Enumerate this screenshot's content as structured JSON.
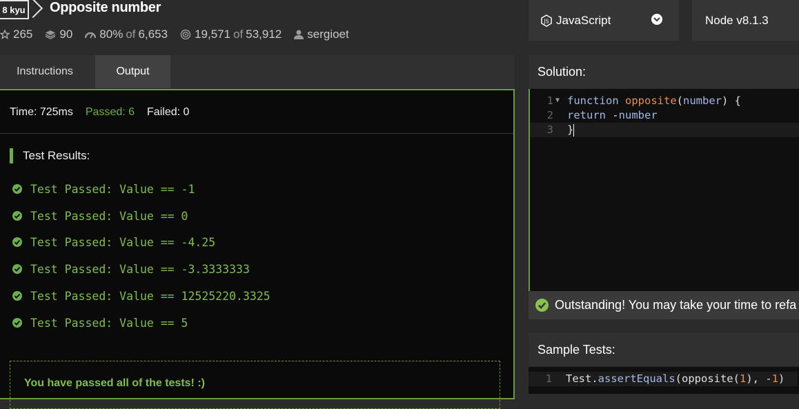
{
  "kata": {
    "kyu": "8 kyu",
    "title": "Opposite number",
    "stats": {
      "stars": "265",
      "collections": "90",
      "satisfaction_pct": "80%",
      "satisfaction_of": "of",
      "satisfaction_votes": "6,653",
      "completed": "19,571",
      "completed_of": "of",
      "attempted": "53,912",
      "author": "sergioet"
    }
  },
  "language": {
    "name": "JavaScript",
    "icon": "nodejs-icon"
  },
  "runtime": {
    "version": "Node v8.1.3"
  },
  "tabs": [
    {
      "label": "Instructions",
      "active": false
    },
    {
      "label": "Output",
      "active": true
    }
  ],
  "output": {
    "time_label": "Time: 725ms",
    "passed_label": "Passed: 6",
    "failed_label": "Failed: 0",
    "results_title": "Test Results:",
    "tests": [
      "Test Passed: Value == -1",
      "Test Passed: Value == 0",
      "Test Passed: Value == -4.25",
      "Test Passed: Value == -3.3333333",
      "Test Passed: Value == 12525220.3325",
      "Test Passed: Value == 5"
    ],
    "final_message": "You have passed all of the tests! :)"
  },
  "solution": {
    "title": "Solution:",
    "lines": [
      {
        "n": "1",
        "parts": [
          [
            "kw",
            "function "
          ],
          [
            "fn",
            "opposite"
          ],
          [
            "plain",
            "("
          ],
          [
            "param",
            "number"
          ],
          [
            "plain",
            ") {"
          ]
        ]
      },
      {
        "n": "2",
        "parts": [
          [
            "kw",
            "return "
          ],
          [
            "plain",
            "-"
          ],
          [
            "param",
            "number"
          ]
        ]
      },
      {
        "n": "3",
        "parts": [
          [
            "plain",
            "}"
          ]
        ]
      }
    ]
  },
  "feedback": {
    "message": "Outstanding! You may take your time to refa"
  },
  "sample_tests": {
    "title": "Sample Tests:",
    "lines": [
      {
        "n": "1",
        "parts": [
          [
            "plain",
            "Test."
          ],
          [
            "meth",
            "assertEquals"
          ],
          [
            "plain",
            "(opposite("
          ],
          [
            "num",
            "1"
          ],
          [
            "plain",
            "), -"
          ],
          [
            "num",
            "1"
          ],
          [
            "plain",
            ")"
          ]
        ]
      }
    ]
  },
  "colors": {
    "accent_green": "#6ab04c",
    "panel_border": "#6b9c3b",
    "keyword": "#a6b8e6",
    "function_name": "#e6914a"
  }
}
